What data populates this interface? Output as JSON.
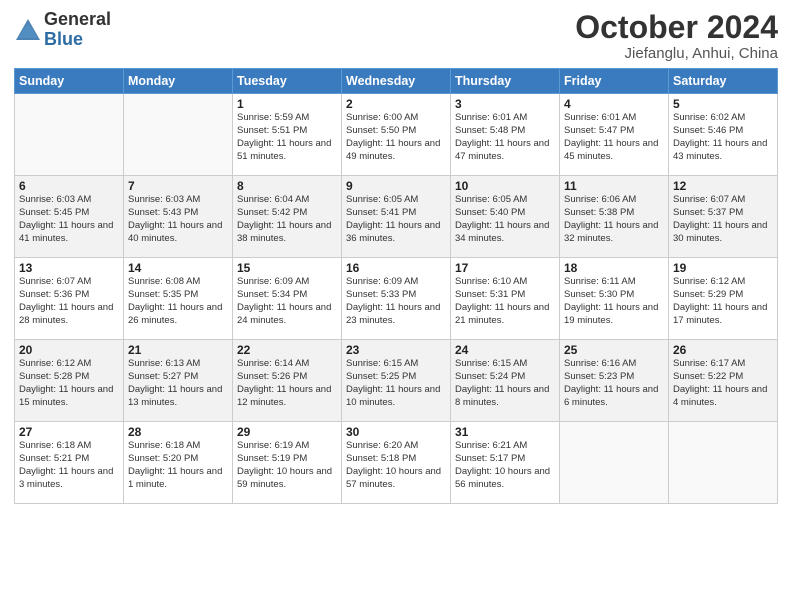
{
  "header": {
    "logo_general": "General",
    "logo_blue": "Blue",
    "month": "October 2024",
    "location": "Jiefanglu, Anhui, China"
  },
  "days_of_week": [
    "Sunday",
    "Monday",
    "Tuesday",
    "Wednesday",
    "Thursday",
    "Friday",
    "Saturday"
  ],
  "weeks": [
    [
      {
        "day": "",
        "info": ""
      },
      {
        "day": "",
        "info": ""
      },
      {
        "day": "1",
        "info": "Sunrise: 5:59 AM\nSunset: 5:51 PM\nDaylight: 11 hours and 51 minutes."
      },
      {
        "day": "2",
        "info": "Sunrise: 6:00 AM\nSunset: 5:50 PM\nDaylight: 11 hours and 49 minutes."
      },
      {
        "day": "3",
        "info": "Sunrise: 6:01 AM\nSunset: 5:48 PM\nDaylight: 11 hours and 47 minutes."
      },
      {
        "day": "4",
        "info": "Sunrise: 6:01 AM\nSunset: 5:47 PM\nDaylight: 11 hours and 45 minutes."
      },
      {
        "day": "5",
        "info": "Sunrise: 6:02 AM\nSunset: 5:46 PM\nDaylight: 11 hours and 43 minutes."
      }
    ],
    [
      {
        "day": "6",
        "info": "Sunrise: 6:03 AM\nSunset: 5:45 PM\nDaylight: 11 hours and 41 minutes."
      },
      {
        "day": "7",
        "info": "Sunrise: 6:03 AM\nSunset: 5:43 PM\nDaylight: 11 hours and 40 minutes."
      },
      {
        "day": "8",
        "info": "Sunrise: 6:04 AM\nSunset: 5:42 PM\nDaylight: 11 hours and 38 minutes."
      },
      {
        "day": "9",
        "info": "Sunrise: 6:05 AM\nSunset: 5:41 PM\nDaylight: 11 hours and 36 minutes."
      },
      {
        "day": "10",
        "info": "Sunrise: 6:05 AM\nSunset: 5:40 PM\nDaylight: 11 hours and 34 minutes."
      },
      {
        "day": "11",
        "info": "Sunrise: 6:06 AM\nSunset: 5:38 PM\nDaylight: 11 hours and 32 minutes."
      },
      {
        "day": "12",
        "info": "Sunrise: 6:07 AM\nSunset: 5:37 PM\nDaylight: 11 hours and 30 minutes."
      }
    ],
    [
      {
        "day": "13",
        "info": "Sunrise: 6:07 AM\nSunset: 5:36 PM\nDaylight: 11 hours and 28 minutes."
      },
      {
        "day": "14",
        "info": "Sunrise: 6:08 AM\nSunset: 5:35 PM\nDaylight: 11 hours and 26 minutes."
      },
      {
        "day": "15",
        "info": "Sunrise: 6:09 AM\nSunset: 5:34 PM\nDaylight: 11 hours and 24 minutes."
      },
      {
        "day": "16",
        "info": "Sunrise: 6:09 AM\nSunset: 5:33 PM\nDaylight: 11 hours and 23 minutes."
      },
      {
        "day": "17",
        "info": "Sunrise: 6:10 AM\nSunset: 5:31 PM\nDaylight: 11 hours and 21 minutes."
      },
      {
        "day": "18",
        "info": "Sunrise: 6:11 AM\nSunset: 5:30 PM\nDaylight: 11 hours and 19 minutes."
      },
      {
        "day": "19",
        "info": "Sunrise: 6:12 AM\nSunset: 5:29 PM\nDaylight: 11 hours and 17 minutes."
      }
    ],
    [
      {
        "day": "20",
        "info": "Sunrise: 6:12 AM\nSunset: 5:28 PM\nDaylight: 11 hours and 15 minutes."
      },
      {
        "day": "21",
        "info": "Sunrise: 6:13 AM\nSunset: 5:27 PM\nDaylight: 11 hours and 13 minutes."
      },
      {
        "day": "22",
        "info": "Sunrise: 6:14 AM\nSunset: 5:26 PM\nDaylight: 11 hours and 12 minutes."
      },
      {
        "day": "23",
        "info": "Sunrise: 6:15 AM\nSunset: 5:25 PM\nDaylight: 11 hours and 10 minutes."
      },
      {
        "day": "24",
        "info": "Sunrise: 6:15 AM\nSunset: 5:24 PM\nDaylight: 11 hours and 8 minutes."
      },
      {
        "day": "25",
        "info": "Sunrise: 6:16 AM\nSunset: 5:23 PM\nDaylight: 11 hours and 6 minutes."
      },
      {
        "day": "26",
        "info": "Sunrise: 6:17 AM\nSunset: 5:22 PM\nDaylight: 11 hours and 4 minutes."
      }
    ],
    [
      {
        "day": "27",
        "info": "Sunrise: 6:18 AM\nSunset: 5:21 PM\nDaylight: 11 hours and 3 minutes."
      },
      {
        "day": "28",
        "info": "Sunrise: 6:18 AM\nSunset: 5:20 PM\nDaylight: 11 hours and 1 minute."
      },
      {
        "day": "29",
        "info": "Sunrise: 6:19 AM\nSunset: 5:19 PM\nDaylight: 10 hours and 59 minutes."
      },
      {
        "day": "30",
        "info": "Sunrise: 6:20 AM\nSunset: 5:18 PM\nDaylight: 10 hours and 57 minutes."
      },
      {
        "day": "31",
        "info": "Sunrise: 6:21 AM\nSunset: 5:17 PM\nDaylight: 10 hours and 56 minutes."
      },
      {
        "day": "",
        "info": ""
      },
      {
        "day": "",
        "info": ""
      }
    ]
  ]
}
